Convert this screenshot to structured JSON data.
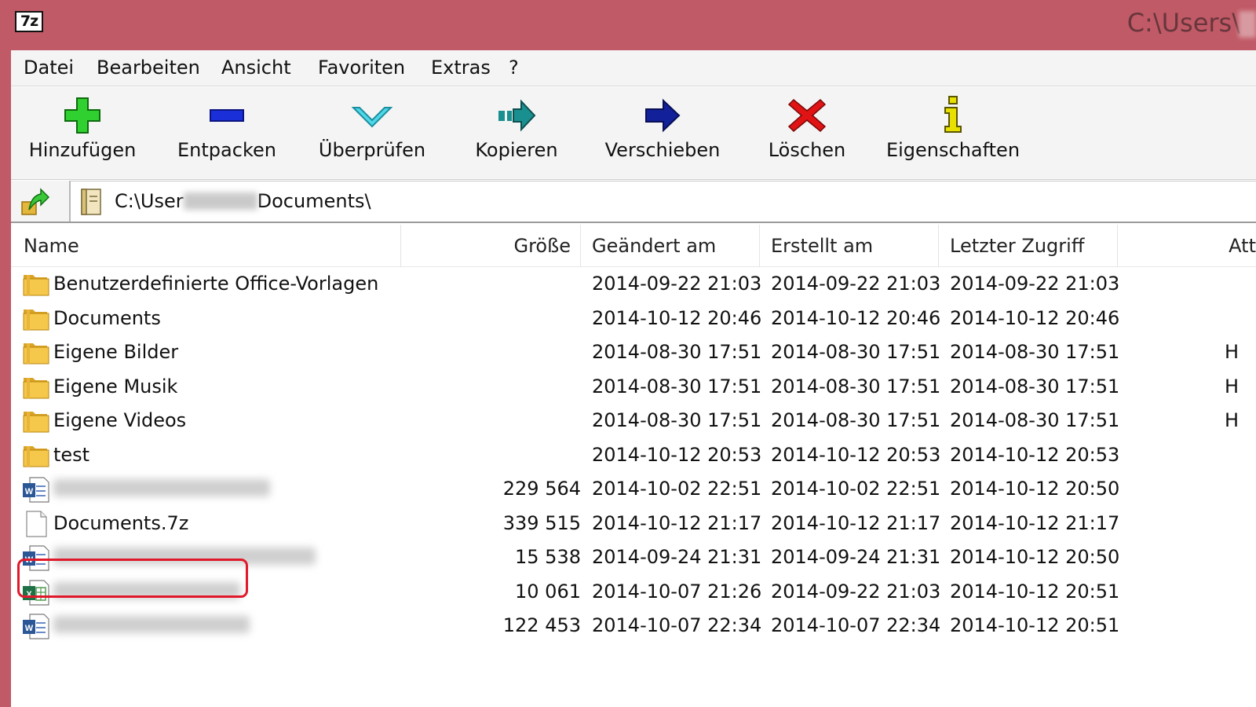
{
  "titlebar": {
    "app_icon_text": "7z",
    "title": "C:\\Users\\"
  },
  "menu": [
    {
      "label": "Datei"
    },
    {
      "label": "Bearbeiten"
    },
    {
      "label": "Ansicht"
    },
    {
      "label": "Favoriten"
    },
    {
      "label": "Extras"
    },
    {
      "label": "?"
    }
  ],
  "toolbar": [
    {
      "label": "Hinzufügen",
      "icon": "add-icon",
      "color": "#2fd02f"
    },
    {
      "label": "Entpacken",
      "icon": "extract-icon",
      "color": "#1a2fd8"
    },
    {
      "label": "Überprüfen",
      "icon": "test-icon",
      "color": "#29b8c8"
    },
    {
      "label": "Kopieren",
      "icon": "copy-icon",
      "color": "#1a8f8f"
    },
    {
      "label": "Verschieben",
      "icon": "move-icon",
      "color": "#12209a"
    },
    {
      "label": "Löschen",
      "icon": "delete-icon",
      "color": "#e01414"
    },
    {
      "label": "Eigenschaften",
      "icon": "info-icon",
      "color": "#e8e000"
    }
  ],
  "address": {
    "prefix": "C:\\User",
    "suffix": "Documents\\"
  },
  "columns": {
    "name": "Name",
    "size": "Größe",
    "modified": "Geändert am",
    "created": "Erstellt am",
    "accessed": "Letzter Zugriff",
    "attributes": "Att"
  },
  "files": [
    {
      "type": "folder",
      "name": "Benutzerdefinierte Office-Vorlagen",
      "size": "",
      "modified": "2014-09-22 21:03",
      "created": "2014-09-22 21:03",
      "accessed": "2014-09-22 21:03",
      "attr": ""
    },
    {
      "type": "folder",
      "name": "Documents",
      "size": "",
      "modified": "2014-10-12 20:46",
      "created": "2014-10-12 20:46",
      "accessed": "2014-10-12 20:46",
      "attr": ""
    },
    {
      "type": "folder",
      "name": "Eigene Bilder",
      "size": "",
      "modified": "2014-08-30 17:51",
      "created": "2014-08-30 17:51",
      "accessed": "2014-08-30 17:51",
      "attr": "H"
    },
    {
      "type": "folder",
      "name": "Eigene Musik",
      "size": "",
      "modified": "2014-08-30 17:51",
      "created": "2014-08-30 17:51",
      "accessed": "2014-08-30 17:51",
      "attr": "H"
    },
    {
      "type": "folder",
      "name": "Eigene Videos",
      "size": "",
      "modified": "2014-08-30 17:51",
      "created": "2014-08-30 17:51",
      "accessed": "2014-08-30 17:51",
      "attr": "H"
    },
    {
      "type": "folder",
      "name": "test",
      "size": "",
      "modified": "2014-10-12 20:53",
      "created": "2014-10-12 20:53",
      "accessed": "2014-10-12 20:53",
      "attr": ""
    },
    {
      "type": "word",
      "name": "",
      "size": "229 564",
      "modified": "2014-10-02 22:51",
      "created": "2014-10-02 22:51",
      "accessed": "2014-10-12 20:50",
      "attr": ""
    },
    {
      "type": "file",
      "name": "Documents.7z",
      "size": "339 515",
      "modified": "2014-10-12 21:17",
      "created": "2014-10-12 21:17",
      "accessed": "2014-10-12 21:17",
      "attr": ""
    },
    {
      "type": "word",
      "name": "",
      "size": "15 538",
      "modified": "2014-09-24 21:31",
      "created": "2014-09-24 21:31",
      "accessed": "2014-10-12 20:50",
      "attr": ""
    },
    {
      "type": "excel",
      "name": "",
      "size": "10 061",
      "modified": "2014-10-07 21:26",
      "created": "2014-09-22 21:03",
      "accessed": "2014-10-12 20:51",
      "attr": ""
    },
    {
      "type": "word",
      "name": "",
      "size": "122 453",
      "modified": "2014-10-07 22:34",
      "created": "2014-10-07 22:34",
      "accessed": "2014-10-12 20:51",
      "attr": ""
    }
  ]
}
